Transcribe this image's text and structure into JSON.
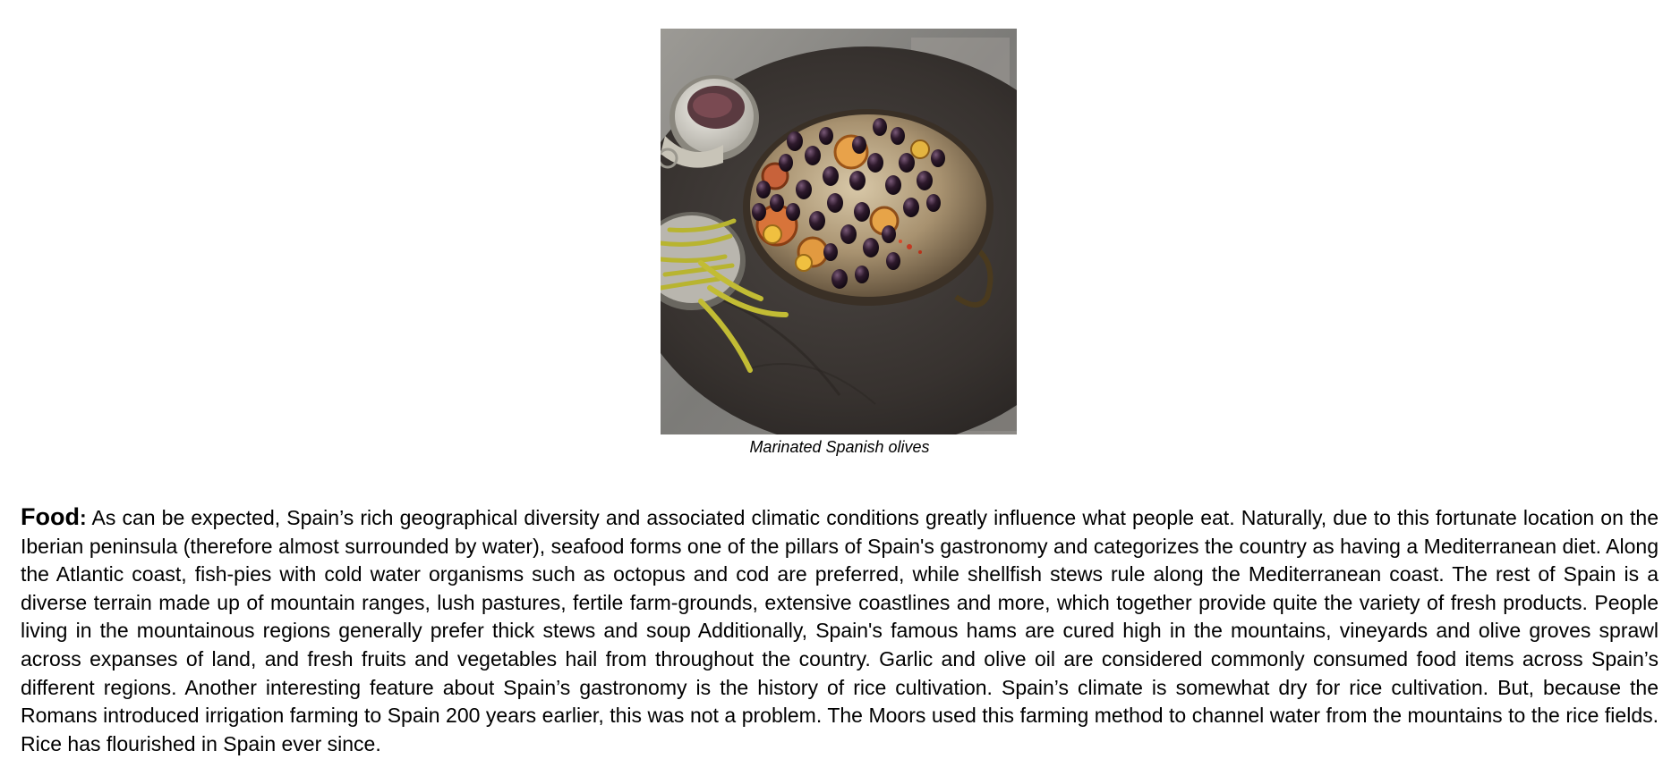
{
  "figure": {
    "image_name": "marinated-olives-photo",
    "caption": "Marinated Spanish olives"
  },
  "section": {
    "heading": "Food",
    "colon": ":",
    "text": " As can be expected, Spain’s rich geographical diversity and associated climatic conditions greatly influence what people eat. Naturally, due to this fortunate location on the Iberian peninsula (therefore almost surrounded by water), seafood forms one of the pillars of Spain's gastronomy and categorizes the country as having a Mediterranean diet. Along the Atlantic coast, fish-pies with cold water organisms such as octopus and cod are preferred, while shellfish stews rule along the Mediterranean coast. The rest of Spain is a diverse terrain made up of mountain ranges, lush pastures, fertile farm-grounds, extensive coastlines and more, which together provide quite the variety of fresh products. People living in the mountainous regions generally prefer thick stews and soup  Additionally, Spain's famous hams are cured high in the mountains, vineyards and olive groves sprawl across expanses of land, and fresh fruits and vegetables hail from throughout the country. Garlic and olive oil are considered commonly consumed food items across Spain’s different regions. Another interesting feature about Spain’s gastronomy is the history of rice cultivation. Spain’s climate is somewhat dry for rice cultivation. But, because the Romans introduced irrigation farming to Spain 200 years earlier, this was not a problem. The Moors used this farming method to channel water from the mountains to the rice fields. Rice has flourished in Spain ever since."
  }
}
